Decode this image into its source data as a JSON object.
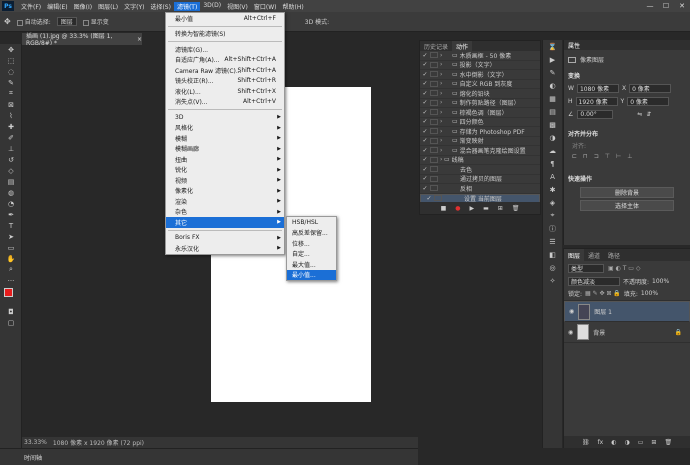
{
  "app": {
    "logo": "Ps"
  },
  "menubar": {
    "items": [
      "文件(F)",
      "编辑(E)",
      "图像(I)",
      "图层(L)",
      "文字(Y)",
      "选择(S)",
      "滤镜(T)",
      "3D(D)",
      "视图(V)",
      "窗口(W)",
      "帮助(H)"
    ],
    "active_index": 6
  },
  "window_controls": {
    "minimize": "—",
    "maximize": "☐",
    "close": "✕"
  },
  "options_bar": {
    "auto_select_label": "自动选择:",
    "layer_select": "图层",
    "show_transform_label": "显示变",
    "mode_3d": "3D 模式:"
  },
  "document": {
    "tab_title": "插画 (1).jpg @ 33.3% (图层 1, RGB/8#) *",
    "tab_close": "×",
    "zoom": "33.33%",
    "size_info": "1080 像素 x 1920 像素 (72 ppi)"
  },
  "timeline": {
    "label": "时间轴"
  },
  "filter_menu": {
    "groups": [
      [
        {
          "label": "最小值",
          "shortcut": "Alt+Ctrl+F"
        }
      ],
      [
        {
          "label": "转换为智能滤镜(S)"
        }
      ],
      [
        {
          "label": "滤镜库(G)..."
        },
        {
          "label": "自适应广角(A)...",
          "shortcut": "Alt+Shift+Ctrl+A"
        },
        {
          "label": "Camera Raw 滤镜(C)...",
          "shortcut": "Shift+Ctrl+A"
        },
        {
          "label": "镜头校正(R)...",
          "shortcut": "Shift+Ctrl+R"
        },
        {
          "label": "液化(L)...",
          "shortcut": "Shift+Ctrl+X"
        },
        {
          "label": "消失点(V)...",
          "shortcut": "Alt+Ctrl+V"
        }
      ],
      [
        {
          "label": "3D",
          "sub": true
        },
        {
          "label": "风格化",
          "sub": true
        },
        {
          "label": "模糊",
          "sub": true
        },
        {
          "label": "模糊画廊",
          "sub": true
        },
        {
          "label": "扭曲",
          "sub": true
        },
        {
          "label": "锐化",
          "sub": true
        },
        {
          "label": "视频",
          "sub": true
        },
        {
          "label": "像素化",
          "sub": true
        },
        {
          "label": "渲染",
          "sub": true
        },
        {
          "label": "杂色",
          "sub": true
        },
        {
          "label": "其它",
          "sub": true,
          "highlighted": true
        }
      ],
      [
        {
          "label": "Boris FX",
          "sub": true
        },
        {
          "label": "永乐汉化",
          "sub": true
        }
      ]
    ]
  },
  "other_submenu": {
    "items": [
      "HSB/HSL",
      "高反差保留...",
      "位移...",
      "自定...",
      "最大值...",
      "最小值..."
    ],
    "highlighted_index": 5
  },
  "actions_panel": {
    "tabs": [
      "历史记录",
      "动作"
    ],
    "active_tab": 1,
    "rows": [
      {
        "label": "木质画框 - 50 像素",
        "indent": 1
      },
      {
        "label": "投影（文字）",
        "indent": 1
      },
      {
        "label": "水中倒影（文字）",
        "indent": 1
      },
      {
        "label": "自定义 RGB 到灰度",
        "indent": 1
      },
      {
        "label": "熔化的铅块",
        "indent": 1
      },
      {
        "label": "制作剪贴路径（图层）",
        "indent": 1
      },
      {
        "label": "棕褐色调（图层）",
        "indent": 1
      },
      {
        "label": "四分颜色",
        "indent": 1
      },
      {
        "label": "存储为 Photoshop PDF",
        "indent": 1
      },
      {
        "label": "渐变映射",
        "indent": 1
      },
      {
        "label": "混合器画笔克隆绘图设置",
        "indent": 1
      },
      {
        "label": "线稿",
        "indent": 0
      },
      {
        "label": "去色",
        "indent": 2
      },
      {
        "label": "通过拷贝的图层",
        "indent": 2
      },
      {
        "label": "反相",
        "indent": 2
      },
      {
        "label": "设置 当前图层",
        "indent": 2,
        "selected": true
      }
    ],
    "buttons": [
      "■",
      "●",
      "▶",
      "▬",
      "⊞",
      "🗑"
    ]
  },
  "properties": {
    "title": "属性",
    "subtitle": "像素图层",
    "transform_label": "变换",
    "w_label": "W",
    "w_value": "1080 像素",
    "x_label": "X",
    "x_value": "0 像素",
    "h_label": "H",
    "h_value": "1920 像素",
    "y_label": "Y",
    "y_value": "0 像素",
    "angle": "0.00°",
    "align_label": "对齐并分布",
    "align_sub": "对齐:",
    "quick_label": "快速操作",
    "remove_bg": "删除背景",
    "select_subject": "选择主体"
  },
  "layers": {
    "tabs": [
      "图层",
      "通道",
      "路径"
    ],
    "active_tab": 0,
    "filter": "类型",
    "blend": "颜色减淡",
    "opacity_label": "不透明度:",
    "opacity": "100%",
    "lock_label": "锁定:",
    "fill_label": "填充:",
    "fill": "100%",
    "items": [
      {
        "name": "图层 1",
        "selected": true
      },
      {
        "name": "背景",
        "locked": true
      }
    ],
    "buttons": [
      "⛓",
      "fx",
      "◐",
      "◑",
      "▭",
      "⊞",
      "🗑"
    ]
  }
}
